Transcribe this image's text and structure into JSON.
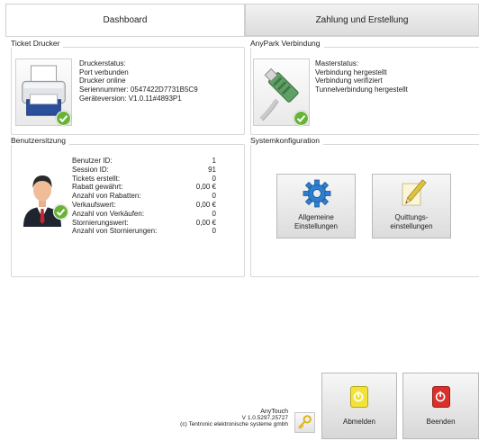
{
  "tabs": [
    {
      "label": "Dashboard",
      "active": true
    },
    {
      "label": "Zahlung und Erstellung",
      "active": false
    }
  ],
  "printer": {
    "title": "Ticket Drucker",
    "icon": "printer-icon",
    "lines": [
      "Druckerstatus:",
      "Port verbunden",
      "Drucker online",
      "Seriennummer: 0547422D7731B5C9",
      "Geräteversion: V1.0.11#4893P1"
    ]
  },
  "anypark": {
    "title": "AnyPark Verbindung",
    "icon": "network-cable-icon",
    "lines": [
      "Masterstatus:",
      "Verbindung hergestellt",
      "Verbindung verifiziert",
      "Tunnelverbindung hergestellt"
    ]
  },
  "session": {
    "title": "Benutzersitzung",
    "icon": "user-avatar-icon",
    "stats": [
      {
        "label": "Benutzer ID:",
        "value": "1"
      },
      {
        "label": "Session ID:",
        "value": "91"
      },
      {
        "label": "Tickets erstellt:",
        "value": "0"
      },
      {
        "label": "Rabatt gewährt:",
        "value": "0,00 €"
      },
      {
        "label": "Anzahl von Rabatten:",
        "value": "0"
      },
      {
        "label": "Verkaufswert:",
        "value": "0,00 €"
      },
      {
        "label": "Anzahl von Verkäufen:",
        "value": "0"
      },
      {
        "label": "Stornierungswert:",
        "value": "0,00 €"
      },
      {
        "label": "Anzahl von Stornierungen:",
        "value": "0"
      }
    ]
  },
  "config": {
    "title": "Systemkonfiguration",
    "general": {
      "line1": "Allgemeine",
      "line2": "Einstellungen",
      "icon": "gear-icon"
    },
    "receipt": {
      "line1": "Quittungs-",
      "line2": "einstellungen",
      "icon": "pencil-paper-icon"
    }
  },
  "footer": {
    "app": "AnyTouch",
    "version": "V 1.0.5297.25727",
    "copyright": "(c) Tentronic elektronische systeme gmbh",
    "key_icon": "key-icon"
  },
  "buttons": {
    "logout": {
      "label": "Abmelden",
      "color": "#f2e33a",
      "icon": "power-icon"
    },
    "quit": {
      "label": "Beenden",
      "color": "#d9302b",
      "icon": "power-icon"
    }
  },
  "status_color": "#67b338"
}
